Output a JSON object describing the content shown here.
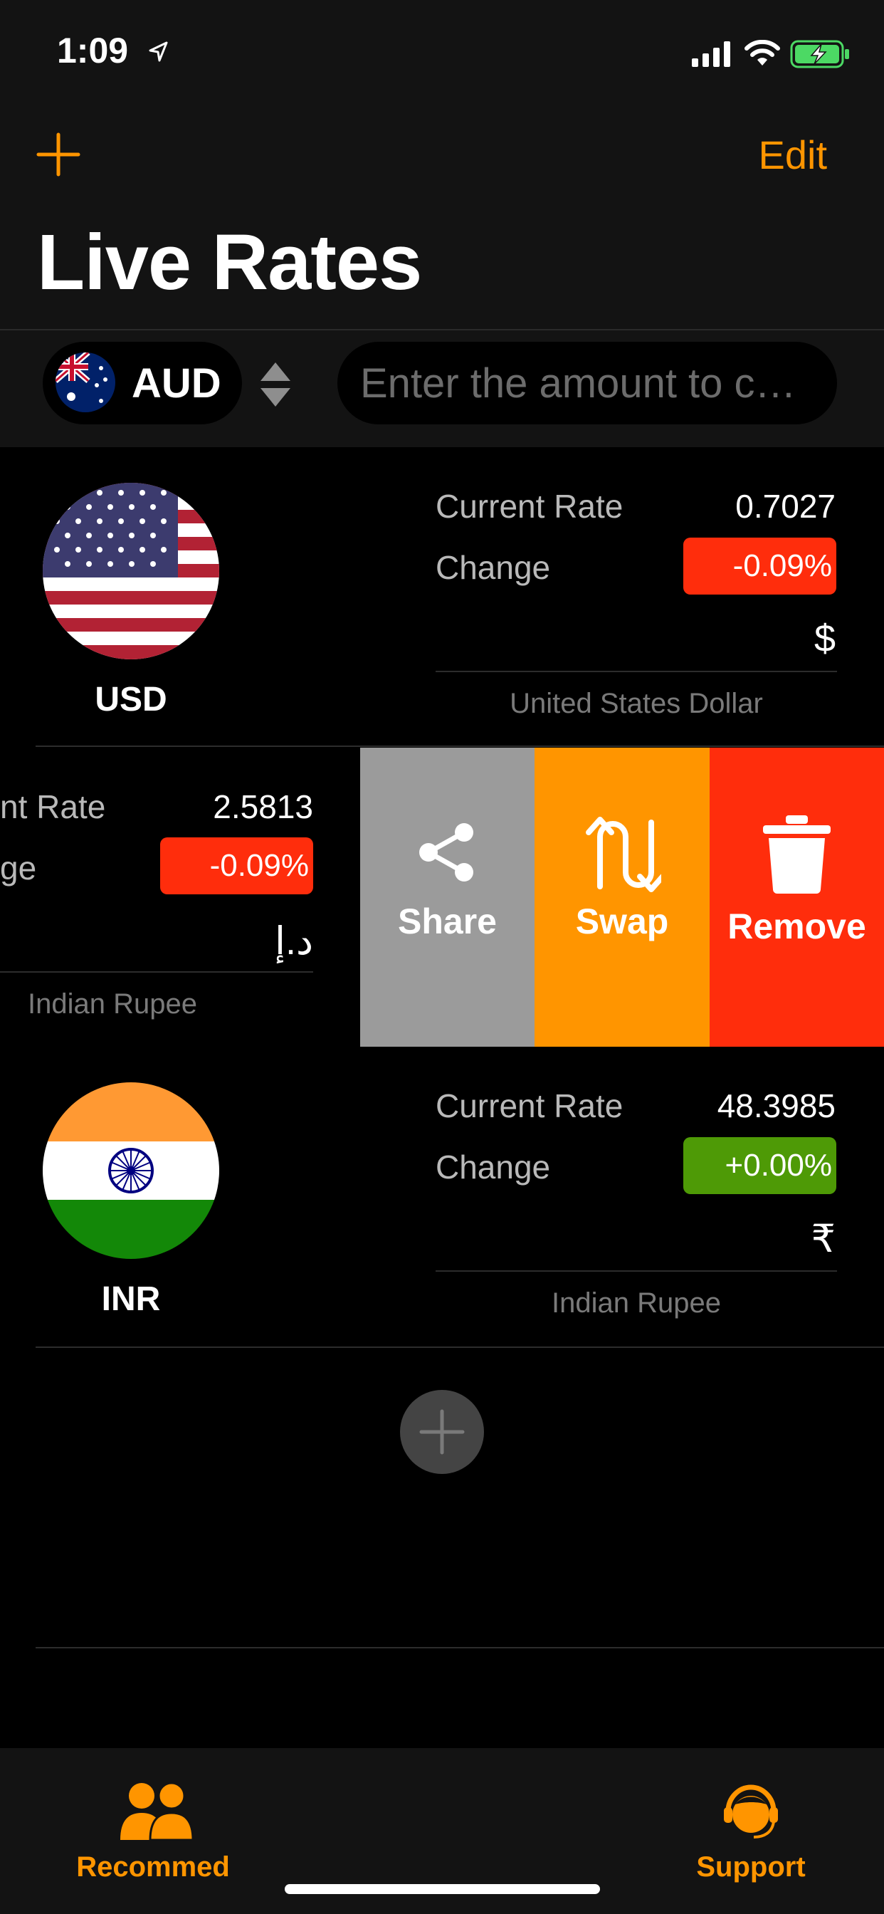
{
  "status_bar": {
    "time": "1:09"
  },
  "nav": {
    "edit_label": "Edit",
    "title": "Live Rates"
  },
  "base": {
    "code": "AUD",
    "amount_placeholder": "Enter the amount to c…"
  },
  "rows": [
    {
      "code": "USD",
      "rate_label": "Current Rate",
      "rate": "0.7027",
      "change_label": "Change",
      "change": "-0.09%",
      "symbol": "$",
      "name": "United States Dollar"
    },
    {
      "code": "",
      "rate_label": "nt Rate",
      "rate": "2.5813",
      "change_label": "ge",
      "change": "-0.09%",
      "symbol": "د.إ",
      "name": "Indian Rupee"
    },
    {
      "code": "INR",
      "rate_label": "Current Rate",
      "rate": "48.3985",
      "change_label": "Change",
      "change": "+0.00%",
      "symbol": "₹",
      "name": "Indian Rupee"
    }
  ],
  "swipe_actions": {
    "share": "Share",
    "swap": "Swap",
    "remove": "Remove"
  },
  "tabbar": {
    "left": "Recommed",
    "right": "Support"
  },
  "colors": {
    "accent": "#ff9500",
    "negative": "#ff2d0c",
    "positive": "#4e9a06",
    "share_bg": "#9b9b9b"
  }
}
